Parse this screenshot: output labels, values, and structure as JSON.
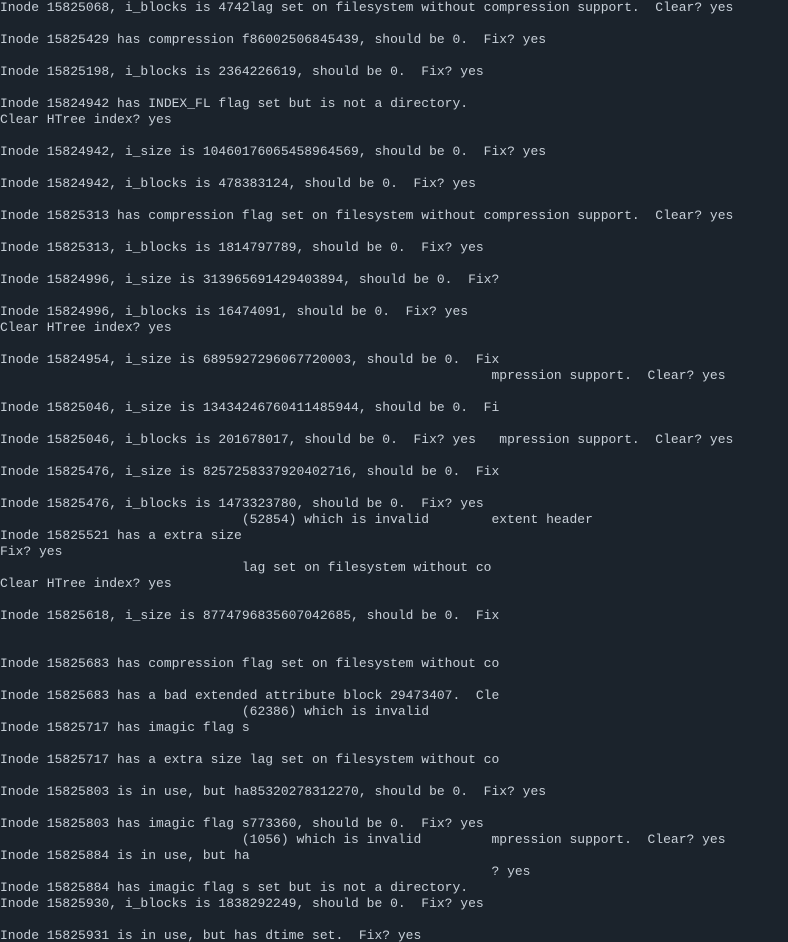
{
  "lines": [
    "Inode 15825068, i_blocks is 4742lag set on filesystem without compression support.  Clear? yes",
    "",
    "Inode 15825429 has compression f86002506845439, should be 0.  Fix? yes",
    "",
    "Inode 15825198, i_blocks is 2364226619, should be 0.  Fix? yes",
    "",
    "Inode 15824942 has INDEX_FL flag set but is not a directory.",
    "Clear HTree index? yes",
    "",
    "Inode 15824942, i_size is 10460176065458964569, should be 0.  Fix? yes",
    "",
    "Inode 15824942, i_blocks is 478383124, should be 0.  Fix? yes",
    "",
    "Inode 15825313 has compression flag set on filesystem without compression support.  Clear? yes",
    "",
    "Inode 15825313, i_blocks is 1814797789, should be 0.  Fix? yes",
    "",
    "Inode 15824996, i_size is 313965691429403894, should be 0.  Fix?",
    "",
    "Inode 15824996, i_blocks is 16474091, should be 0.  Fix? yes",
    "Clear HTree index? yes",
    "",
    "Inode 15824954, i_size is 6895927296067720003, should be 0.  Fix",
    "                                                               mpression support.  Clear? yes",
    "",
    "Inode 15825046, i_size is 13434246760411485944, should be 0.  Fi",
    "",
    "Inode 15825046, i_blocks is 201678017, should be 0.  Fix? yes   mpression support.  Clear? yes",
    "",
    "Inode 15825476, i_size is 8257258337920402716, should be 0.  Fix",
    "",
    "Inode 15825476, i_blocks is 1473323780, should be 0.  Fix? yes",
    "                               (52854) which is invalid        extent header",
    "Inode 15825521 has a extra size",
    "Fix? yes",
    "                               lag set on filesystem without co",
    "Clear HTree index? yes",
    "",
    "Inode 15825618, i_size is 8774796835607042685, should be 0.  Fix",
    "",
    "",
    "Inode 15825683 has compression flag set on filesystem without co",
    "",
    "Inode 15825683 has a bad extended attribute block 29473407.  Cle",
    "                               (62386) which is invalid",
    "Inode 15825717 has imagic flag s",
    "",
    "Inode 15825717 has a extra size lag set on filesystem without co",
    "",
    "Inode 15825803 is in use, but ha85320278312270, should be 0.  Fix? yes",
    "",
    "Inode 15825803 has imagic flag s773360, should be 0.  Fix? yes",
    "                               (1056) which is invalid         mpression support.  Clear? yes",
    "Inode 15825884 is in use, but ha",
    "                                                               ? yes",
    "Inode 15825884 has imagic flag s set but is not a directory.",
    "Inode 15825930, i_blocks is 1838292249, should be 0.  Fix? yes",
    "",
    "Inode 15825931 is in use, but has dtime set.  Fix? yes"
  ]
}
